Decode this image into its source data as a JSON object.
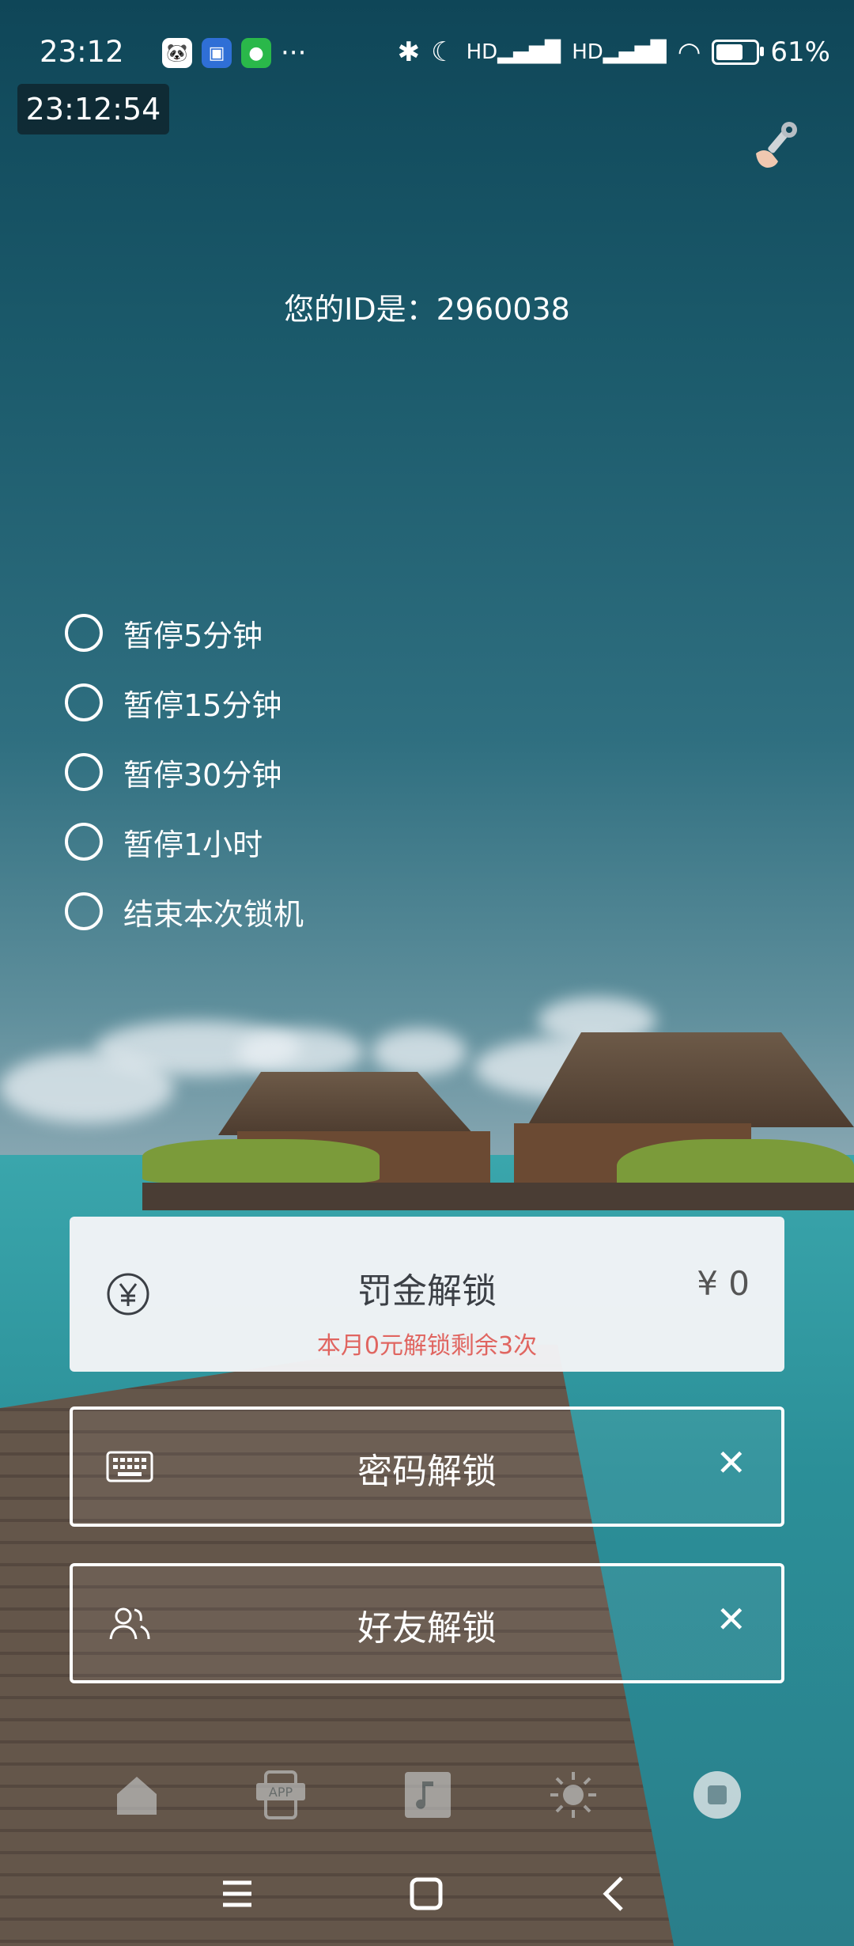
{
  "status_bar": {
    "time": "23:12",
    "more": "···",
    "battery_text": "61%",
    "battery_level": 0.61,
    "notifications": [
      "panda-app-icon",
      "calendar-app-icon",
      "wechat-icon"
    ]
  },
  "clock": "23:12:54",
  "user_id_text": "您的ID是：2960038",
  "pause_options": [
    "暂停5分钟",
    "暂停15分钟",
    "暂停30分钟",
    "暂停1小时",
    "结束本次锁机"
  ],
  "fine_unlock": {
    "title": "罚金解锁",
    "amount": "¥ 0",
    "subtitle": "本月0元解锁剩余3次"
  },
  "password_unlock": {
    "title": "密码解锁",
    "close": "✕"
  },
  "friend_unlock": {
    "title": "好友解锁",
    "close": "✕"
  },
  "tabbar": [
    "home-icon",
    "app-icon",
    "music-icon",
    "brightness-icon",
    "stop-icon"
  ],
  "navbar": [
    "menu-icon",
    "home-square-icon",
    "back-icon"
  ]
}
